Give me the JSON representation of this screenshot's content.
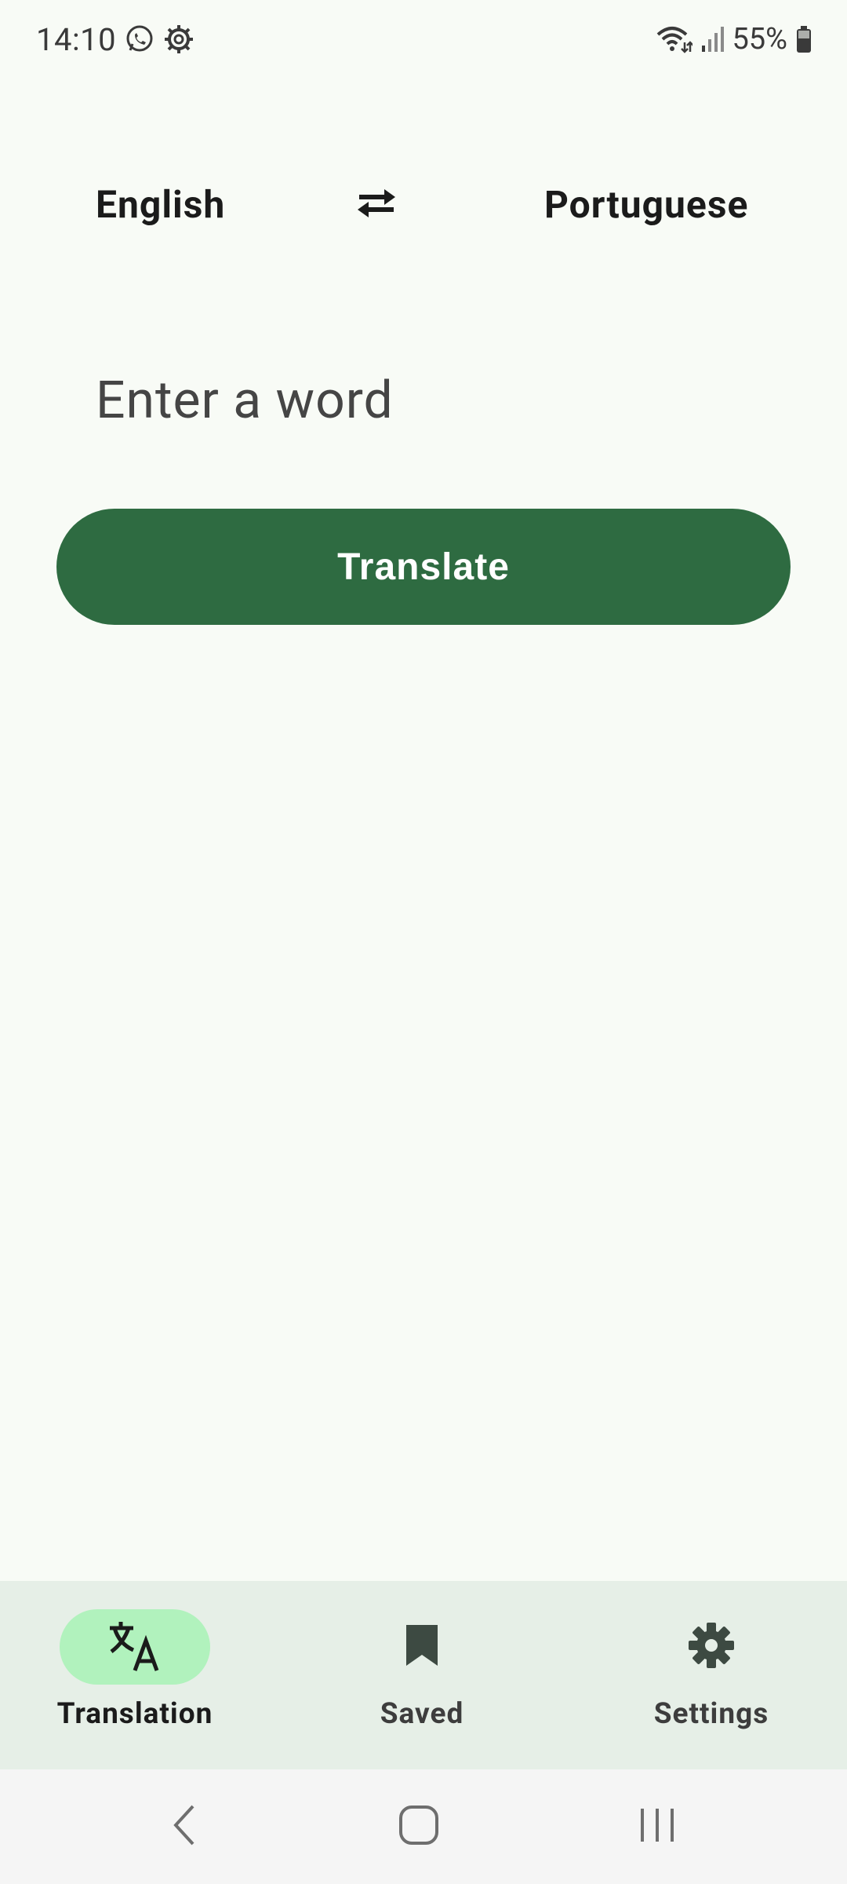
{
  "status_bar": {
    "time": "14:10",
    "battery_percent": "55%",
    "left_icons": [
      "whatsapp-icon",
      "settings-gear-icon"
    ],
    "right_icons": [
      "wifi-icon",
      "signal-icon",
      "battery-icon"
    ]
  },
  "languages": {
    "source": "English",
    "target": "Portuguese",
    "swap_icon": "swap-arrows-icon"
  },
  "input": {
    "placeholder": "Enter a word",
    "value": ""
  },
  "translate_button": {
    "label": "Translate",
    "color": "#2e6b41"
  },
  "bottom_nav": {
    "active": "Translation",
    "active_indicator_color": "#b1f2bd",
    "items": [
      {
        "label": "Translation",
        "icon": "translate-icon"
      },
      {
        "label": "Saved",
        "icon": "bookmark-icon"
      },
      {
        "label": "Settings",
        "icon": "gear-icon"
      }
    ]
  },
  "system_nav": {
    "buttons": [
      "back-icon",
      "home-icon",
      "recents-icon"
    ]
  }
}
